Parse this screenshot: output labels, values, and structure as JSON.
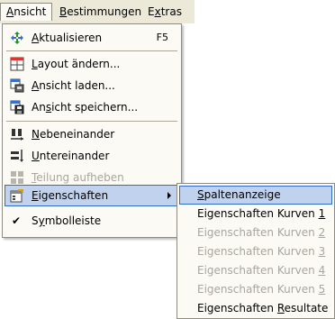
{
  "menubar": {
    "items": [
      {
        "pre": "",
        "key": "A",
        "post": "nsicht"
      },
      {
        "pre": "",
        "key": "B",
        "post": "estimmungen"
      },
      {
        "pre": "E",
        "key": "x",
        "post": "tras"
      }
    ]
  },
  "menu": {
    "items": [
      {
        "pre": "",
        "key": "A",
        "post": "ktualisieren",
        "shortcut": "F5",
        "icon": "refresh-icon"
      },
      {
        "pre": "",
        "key": "L",
        "post": "ayout ändern...",
        "icon": "layout-icon"
      },
      {
        "pre": "",
        "key": "A",
        "post": "nsicht laden...",
        "icon": "load-view-icon"
      },
      {
        "pre": "An",
        "key": "s",
        "post": "icht speichern...",
        "icon": "save-view-icon"
      },
      {
        "pre": "",
        "key": "N",
        "post": "ebeneinander",
        "icon": "side-by-side-icon"
      },
      {
        "pre": "",
        "key": "U",
        "post": "ntereinander",
        "icon": "stacked-icon"
      },
      {
        "pre": "",
        "key": "T",
        "post": "eilung aufheben",
        "icon": "split-remove-icon"
      },
      {
        "pre": "",
        "key": "E",
        "post": "igenschaften",
        "icon": "properties-icon"
      },
      {
        "pre": "S",
        "key": "y",
        "post": "mbolleiste",
        "icon": "check-icon",
        "check": "✔"
      }
    ]
  },
  "submenu": {
    "items": [
      {
        "pre": "",
        "key": "S",
        "post": "paltenanzeige"
      },
      {
        "pre": "Eigenschaften Kurven ",
        "key": "1",
        "post": ""
      },
      {
        "pre": "Eigenschaften Kurven ",
        "key": "2",
        "post": ""
      },
      {
        "pre": "Eigenschaften Kurven ",
        "key": "3",
        "post": ""
      },
      {
        "pre": "Eigenschaften Kurven ",
        "key": "4",
        "post": ""
      },
      {
        "pre": "Eigenschaften Kurven ",
        "key": "5",
        "post": ""
      },
      {
        "pre": "Eigenschaften ",
        "key": "R",
        "post": "esultate"
      }
    ]
  },
  "colors": {
    "menu_background": "#fbfaf5",
    "menubar_background": "#ece9d8",
    "highlight_background": "#c1d2ee",
    "highlight_border": "#316ac5",
    "disabled_text": "#a8a69c"
  }
}
